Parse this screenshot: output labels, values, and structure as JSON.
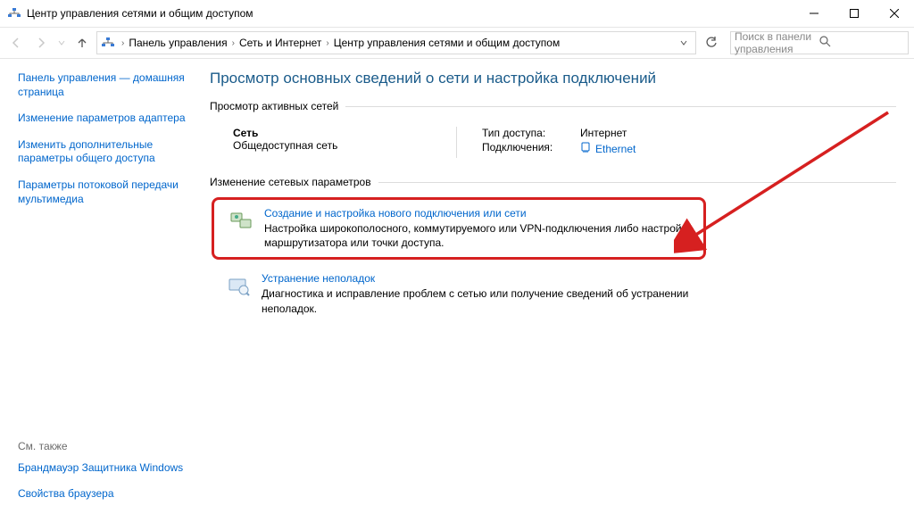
{
  "window": {
    "title": "Центр управления сетями и общим доступом"
  },
  "breadcrumb": {
    "items": [
      "Панель управления",
      "Сеть и Интернет",
      "Центр управления сетями и общим доступом"
    ]
  },
  "search": {
    "placeholder": "Поиск в панели управления"
  },
  "sidebar": {
    "links": [
      "Панель управления — домашняя страница",
      "Изменение параметров адаптера",
      "Изменить дополнительные параметры общего доступа",
      "Параметры потоковой передачи мультимедиа"
    ],
    "see_also_label": "См. также",
    "see_also": [
      "Брандмауэр Защитника Windows",
      "Свойства браузера"
    ]
  },
  "main": {
    "heading": "Просмотр основных сведений о сети и настройка подключений",
    "active_networks_label": "Просмотр активных сетей",
    "network": {
      "name": "Сеть",
      "type": "Общедоступная сеть",
      "access_label": "Тип доступа:",
      "access_value": "Интернет",
      "connections_label": "Подключения:",
      "connection_value": "Ethernet"
    },
    "change_settings_label": "Изменение сетевых параметров",
    "tasks": [
      {
        "title": "Создание и настройка нового подключения или сети",
        "desc": "Настройка широкополосного, коммутируемого или VPN-подключения либо настройка маршрутизатора или точки доступа."
      },
      {
        "title": "Устранение неполадок",
        "desc": "Диагностика и исправление проблем с сетью или получение сведений об устранении неполадок."
      }
    ]
  }
}
